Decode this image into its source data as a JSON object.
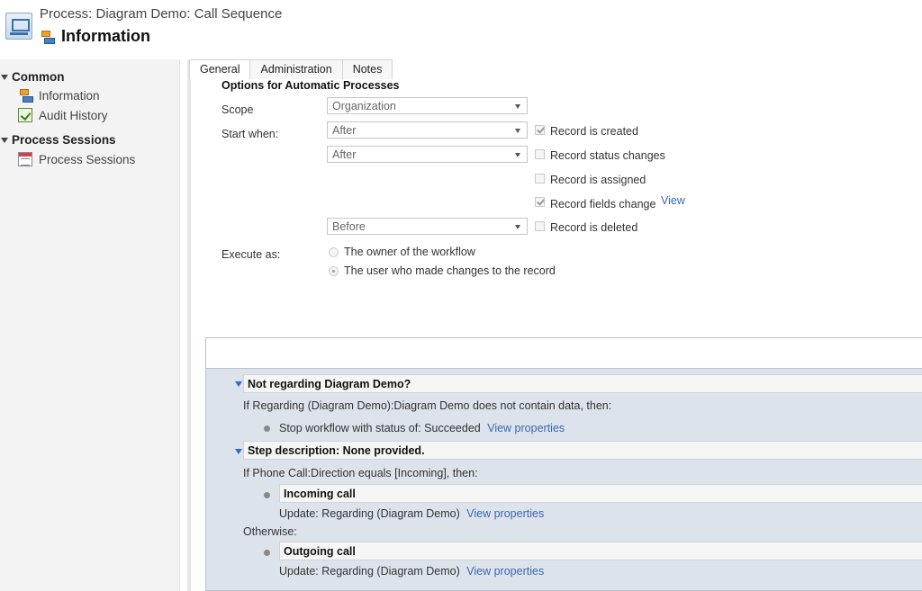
{
  "header": {
    "process_title": "Process: Diagram Demo: Call Sequence",
    "page_title": "Information"
  },
  "sidebar": {
    "groups": [
      {
        "label": "Common",
        "items": [
          {
            "label": "Information",
            "icon": "flow-icon"
          },
          {
            "label": "Audit History",
            "icon": "audit-icon"
          }
        ]
      },
      {
        "label": "Process Sessions",
        "items": [
          {
            "label": "Process Sessions",
            "icon": "sessions-icon"
          }
        ]
      }
    ]
  },
  "tabs": [
    "General",
    "Administration",
    "Notes"
  ],
  "options": {
    "section_title": "Options for Automatic Processes",
    "scope_label": "Scope",
    "scope_value": "Organization",
    "start_when_label": "Start when:",
    "start_selects": [
      "After",
      "After",
      "Before"
    ],
    "checkboxes": [
      {
        "label": "Record is created",
        "checked": true
      },
      {
        "label": "Record status changes",
        "checked": false
      },
      {
        "label": "Record is assigned",
        "checked": false
      },
      {
        "label": "Record fields change",
        "checked": true
      },
      {
        "label": "Record is deleted",
        "checked": false
      }
    ],
    "view_link": "View",
    "execute_label": "Execute as:",
    "radios": [
      {
        "label": "The owner of the workflow",
        "checked": false
      },
      {
        "label": "The user who made changes to the record",
        "checked": true
      }
    ]
  },
  "designer": {
    "step1_title": "Not regarding Diagram Demo?",
    "step1_condition": "If Regarding (Diagram Demo):Diagram Demo does not contain data, then:",
    "step1_action": "Stop workflow with status of:  Succeeded",
    "step2_title": "Step description: None provided.",
    "step2_condition": "If Phone Call:Direction equals [Incoming], then:",
    "incoming_title": "Incoming call",
    "update_text": "Update:  Regarding (Diagram Demo)",
    "otherwise": "Otherwise:",
    "outgoing_title": "Outgoing call",
    "view_properties": "View properties"
  }
}
